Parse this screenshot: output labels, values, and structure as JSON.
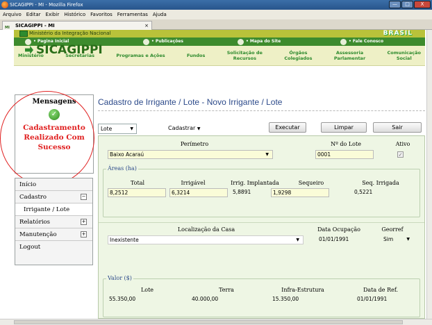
{
  "window": {
    "title": "SICAGIPPI - MI - Mozilla Firefox",
    "minimize": "—",
    "maximize": "□",
    "close": "X"
  },
  "menubar": [
    "Arquivo",
    "Editar",
    "Exibir",
    "Histórico",
    "Favoritos",
    "Ferramentas",
    "Ajuda"
  ],
  "tab": {
    "title": "SICAGIPPI - MI",
    "close": "×",
    "favicon": "MI"
  },
  "header": {
    "ministry": "Ministério da Integração Nacional",
    "brand": "BRASIL",
    "links": [
      "• Pagina Inicial",
      "• Publicações",
      "• Mapa do Site",
      "• Fale Conosco"
    ],
    "nav": [
      [
        "Ministério"
      ],
      [
        "Secretarias"
      ],
      [
        "Programas e Ações"
      ],
      [
        "Fundos"
      ],
      [
        "Solicitação de",
        "Recursos"
      ],
      [
        "Órgãos",
        "Colegiados"
      ],
      [
        "Assessoria",
        "Parlamentar"
      ],
      [
        "Comunicação",
        "Social"
      ]
    ]
  },
  "logo": "SICAGIPPI",
  "messages": {
    "title": "Mensagens",
    "text": [
      "Cadastramento",
      "Realizado Com",
      "Sucesso"
    ]
  },
  "menu": {
    "inicio": "Início",
    "cadastro": "Cadastro",
    "cadastro_box": "−",
    "irrigante": "Irrigante / Lote",
    "relatorios": "Relatórios",
    "relatorios_box": "+",
    "manutencao": "Manutenção",
    "manutencao_box": "+",
    "logout": "Logout"
  },
  "page_title": "Cadastro de Irrigante / Lote - Novo Irrigante / Lote",
  "toolbar": {
    "entity": "Lote",
    "action_menu": "Cadastrar",
    "execute": "Executar",
    "clear": "Limpar",
    "exit": "Sair"
  },
  "form": {
    "perimetro_label": "Perímetro",
    "perimetro_value": "Baixo Acaraú",
    "lote_label": "Nº do Lote",
    "lote_value": "0001",
    "ativo_label": "Ativo",
    "ativo_mark": "✓",
    "areas_legend": "Áreas (ha)",
    "areas": {
      "total_label": "Total",
      "total": "8,2512",
      "irrigavel_label": "Irrigável",
      "irrigavel": "6,3214",
      "implantada_label": "Irrig. Implantada",
      "implantada": "5,8891",
      "sequeiro_label": "Sequeiro",
      "sequeiro": "1,9298",
      "seq_irrigada_label": "Seq. Irrigada",
      "seq_irrigada": "0,5221"
    },
    "localizacao_label": "Localização da Casa",
    "localizacao_value": "Inexistente",
    "data_ocupacao_label": "Data Ocupação",
    "data_ocupacao_value": "01/01/1991",
    "georref_label": "Georref",
    "georref_value": "Sim",
    "valor_legend": "Valor ($)",
    "valor": {
      "lote_label": "Lote",
      "lote": "55.350,00",
      "terra_label": "Terra",
      "terra": "40.000,00",
      "infra_label": "Infra-Estrutura",
      "infra": "15.350,00",
      "data_ref_label": "Data de Ref.",
      "data_ref": "01/01/1991"
    }
  }
}
